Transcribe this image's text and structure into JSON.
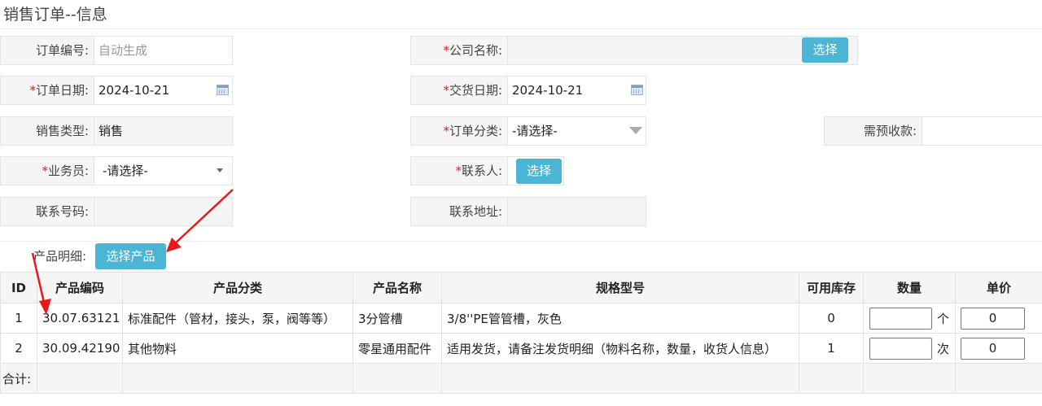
{
  "page": {
    "title": "销售订单--信息"
  },
  "form": {
    "order_no": {
      "label": "订单编号:",
      "placeholder": "自动生成"
    },
    "company_name": {
      "label": "公司名称:",
      "value": "",
      "button": "选择"
    },
    "order_date": {
      "label": "订单日期:",
      "value": "2024-10-21"
    },
    "delivery_date": {
      "label": "交货日期:",
      "value": "2024-10-21"
    },
    "sales_type": {
      "label": "销售类型:",
      "value": "销售"
    },
    "order_category": {
      "label": "订单分类:",
      "value": "-请选择-"
    },
    "prepayment": {
      "label": "需预收款:",
      "value": ""
    },
    "salesperson": {
      "label": "业务员:",
      "value": "-请选择-"
    },
    "contact": {
      "label": "联系人:",
      "button": "选择"
    },
    "contact_phone": {
      "label": "联系号码:",
      "value": ""
    },
    "contact_address": {
      "label": "联系地址:",
      "value": ""
    },
    "product_detail": {
      "label": "产品明细:",
      "button": "选择产品"
    },
    "required_mark": "*"
  },
  "table": {
    "headers": [
      "ID",
      "产品编码",
      "产品分类",
      "产品名称",
      "规格型号",
      "可用库存",
      "数量",
      "单价"
    ],
    "rows": [
      {
        "id": "1",
        "code": "30.07.63121",
        "category": "标准配件（管材，接头，泵，阀等等）",
        "name": "3分管槽",
        "spec": "3/8''PE管管槽，灰色",
        "stock": "0",
        "unit": "个",
        "price": "0"
      },
      {
        "id": "2",
        "code": "30.09.42190",
        "category": "其他物料",
        "name": "零星通用配件",
        "spec": "适用发货，请备注发货明细（物料名称，数量，收货人信息）",
        "stock": "1",
        "unit": "次",
        "price": "0"
      }
    ],
    "total_label": "合计:"
  },
  "colors": {
    "button": "#4bb5d6",
    "required": "#e01b1b",
    "annotation_arrow": "#e8191c"
  }
}
